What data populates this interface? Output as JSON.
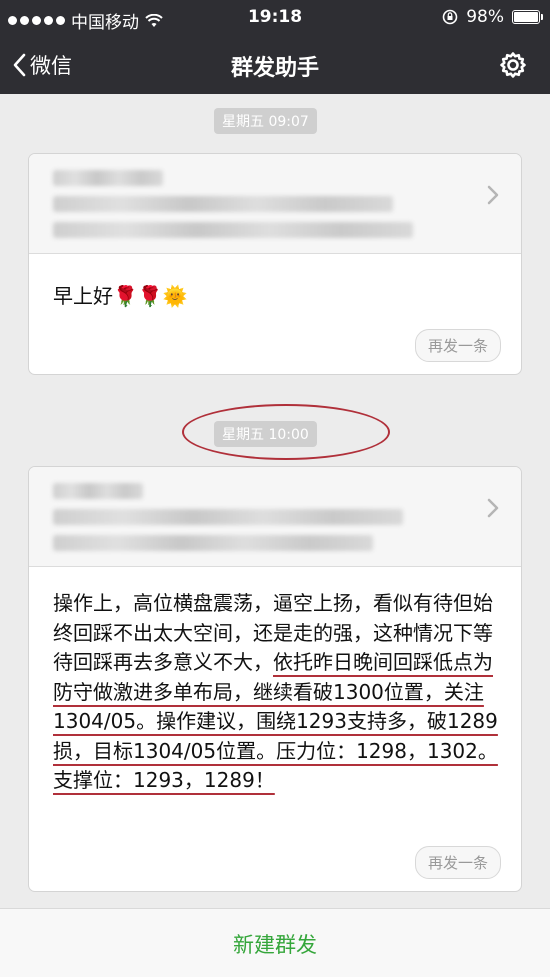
{
  "status_bar": {
    "carrier": "中国移动",
    "time": "19:18",
    "battery": "98%",
    "battery_level": 0.98
  },
  "nav": {
    "back_label": "微信",
    "title": "群发助手"
  },
  "messages": [
    {
      "timestamp": "星期五 09:07",
      "text": "早上好🌹🌹🌞",
      "resend_label": "再发一条"
    },
    {
      "timestamp": "星期五 10:00",
      "text_plain": "操作上，高位横盘震荡，逼空上扬，看似有待但始终回踩不出太大空间，还是走的强，这种情况下等待回踩再去多意义不大，",
      "text_underlined": "依托昨日晚间回踩低点为防守做激进多单布局，继续看破1300位置，关注1304/05。操作建议，围绕1293支持多，破1289损，目标1304/05位置。压力位：1298，1302。支撑位：1293，1289！",
      "resend_label": "再发一条"
    }
  ],
  "footer": {
    "new_broadcast_label": "新建群发"
  },
  "colors": {
    "header_bg": "#2e2e33",
    "accent_green": "#35a63b",
    "annotation_red": "#b0303a"
  }
}
